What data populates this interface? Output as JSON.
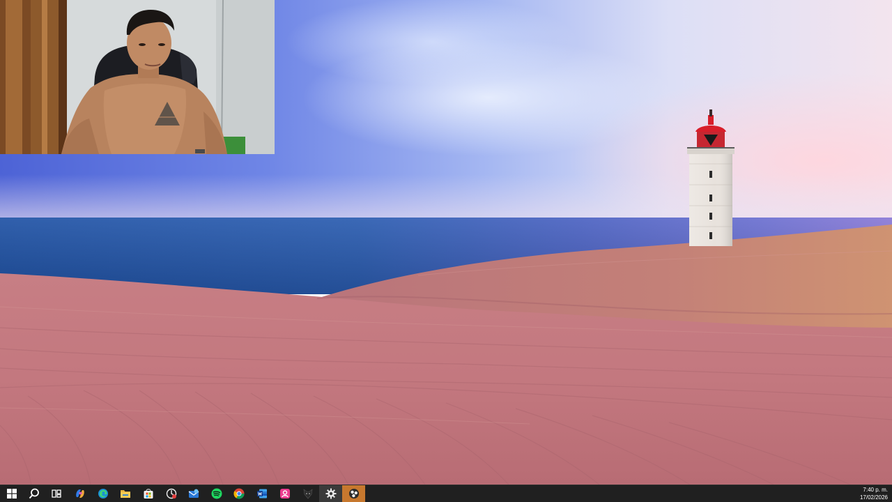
{
  "screen": {
    "title": "Windows desktop"
  },
  "wallpaper": {
    "subject": "lighthouse on sand dunes by the sea",
    "colors": {
      "sky": "#7f95ea",
      "sea": "#2a5cb0",
      "sand": "#c97f86",
      "lighthouse_top": "#d81e2a"
    }
  },
  "webcam": {
    "visible": true,
    "subject": "person seated in gaming chair"
  },
  "taskbar": {
    "background": "#202020",
    "items": [
      {
        "name": "start-button",
        "icon": "windows-logo-icon",
        "active": false
      },
      {
        "name": "search-button",
        "icon": "search-icon",
        "active": false
      },
      {
        "name": "task-view-button",
        "icon": "task-view-icon",
        "active": false
      },
      {
        "name": "copilot-app",
        "icon": "copilot-icon",
        "active": false
      },
      {
        "name": "edge-app",
        "icon": "edge-icon",
        "active": false
      },
      {
        "name": "file-explorer-app",
        "icon": "folder-icon",
        "active": false
      },
      {
        "name": "microsoft-store-app",
        "icon": "store-icon",
        "active": false
      },
      {
        "name": "screen-recorder-app",
        "icon": "recorder-icon",
        "active": false
      },
      {
        "name": "mail-app",
        "icon": "mail-icon",
        "active": false
      },
      {
        "name": "spotify-app",
        "icon": "spotify-icon",
        "active": false
      },
      {
        "name": "chrome-app",
        "icon": "chrome-icon",
        "active": false
      },
      {
        "name": "word-app",
        "icon": "word-icon",
        "active": false
      },
      {
        "name": "pink-app",
        "icon": "pink-app-icon",
        "active": false
      },
      {
        "name": "dark-app",
        "icon": "wolf-icon",
        "active": false
      },
      {
        "name": "settings-app",
        "icon": "gear-icon",
        "active": true
      },
      {
        "name": "obs-app",
        "icon": "obs-icon",
        "active": true
      }
    ],
    "clock": {
      "time": "7:40 p. m.",
      "date": "17/02/2026"
    }
  }
}
